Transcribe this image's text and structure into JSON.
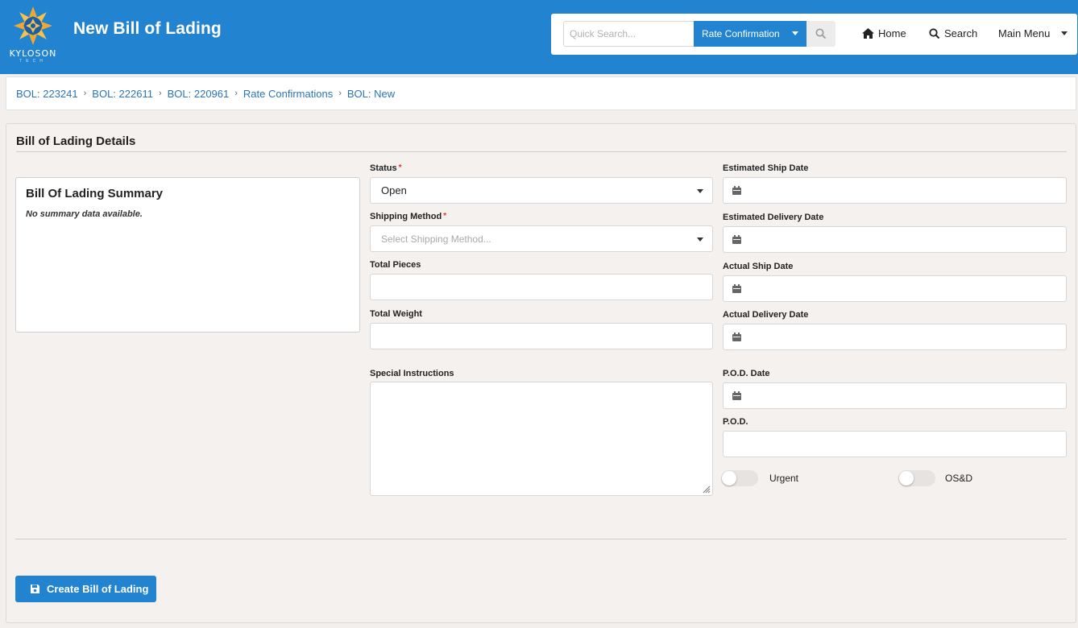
{
  "header": {
    "logo_text": "KYLOSON",
    "logo_subtext": "TECH",
    "title": "New Bill of Lading",
    "quick_search_placeholder": "Quick Search...",
    "search_type": "Rate Confirmation",
    "nav": {
      "home": "Home",
      "search": "Search",
      "main_menu": "Main Menu"
    }
  },
  "breadcrumb": [
    "BOL: 223241",
    "BOL: 222611",
    "BOL: 220961",
    "Rate Confirmations",
    "BOL: New"
  ],
  "card": {
    "title": "Bill of Lading Details",
    "summary": {
      "title": "Bill Of Lading Summary",
      "empty_text": "No summary data available."
    },
    "fields": {
      "status": {
        "label": "Status",
        "value": "Open"
      },
      "shipping_method": {
        "label": "Shipping Method",
        "placeholder": "Select Shipping Method..."
      },
      "total_pieces": {
        "label": "Total Pieces",
        "value": ""
      },
      "total_weight": {
        "label": "Total Weight",
        "value": ""
      },
      "special_instructions": {
        "label": "Special Instructions",
        "value": ""
      },
      "estimated_ship_date": {
        "label": "Estimated Ship Date",
        "value": ""
      },
      "estimated_delivery_date": {
        "label": "Estimated Delivery Date",
        "value": ""
      },
      "actual_ship_date": {
        "label": "Actual Ship Date",
        "value": ""
      },
      "actual_delivery_date": {
        "label": "Actual Delivery Date",
        "value": ""
      },
      "pod_date": {
        "label": "P.O.D. Date",
        "value": ""
      },
      "pod": {
        "label": "P.O.D.",
        "value": ""
      }
    },
    "toggles": {
      "urgent": {
        "label": "Urgent",
        "on": false
      },
      "osd": {
        "label": "OS&D",
        "on": false
      }
    },
    "submit_label": "Create Bill of Lading"
  },
  "colors": {
    "brand": "#2283d0",
    "link": "#2a75b7",
    "required": "#dd3333"
  }
}
